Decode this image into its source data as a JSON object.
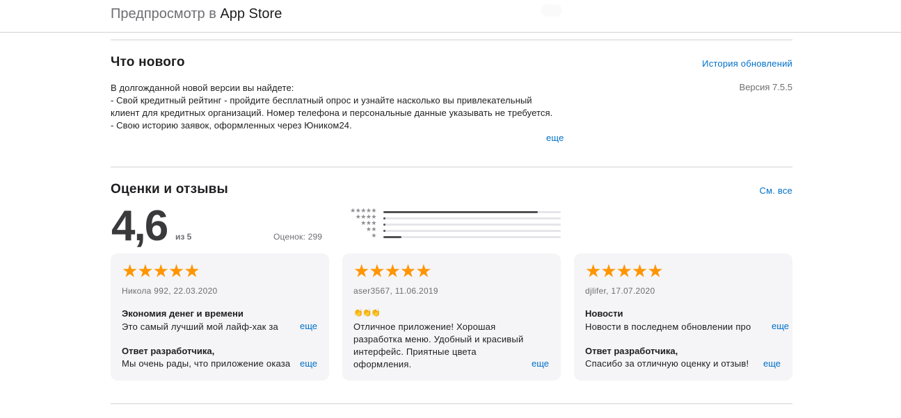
{
  "header": {
    "prefix": "Предпросмотр в",
    "app_store": "App Store"
  },
  "whats_new": {
    "title": "Что нового",
    "history_link": "История обновлений",
    "version": "Версия 7.5.5",
    "text": "В долгожданной новой версии вы найдете:\n- Свой кредитный рейтинг - пройдите бесплатный опрос и узнайте насколько вы привлекательный клиент для кредитных организаций. Номер телефона и персональные данные указывать не требуется.\n- Свою историю заявок, оформленных через Юником24.",
    "more": "еще"
  },
  "ratings": {
    "title": "Оценки и отзывы",
    "see_all": "См. все",
    "average": "4,6",
    "out_of": "из 5",
    "count": "Оценок: 299",
    "histogram": [
      {
        "stars": "★★★★★",
        "fraction": 0.87
      },
      {
        "stars": "★★★★",
        "fraction": 0.01
      },
      {
        "stars": "★★★",
        "fraction": 0.01
      },
      {
        "stars": "★★",
        "fraction": 0.01
      },
      {
        "stars": "★",
        "fraction": 0.1
      }
    ]
  },
  "reviews": [
    {
      "stars": "★★★★★",
      "meta": "Никола 992, 22.03.2020",
      "title": "Экономия денег и времени",
      "body": "Это самый лучший мой лайф-хак за",
      "more": "еще",
      "dev_title": "Ответ разработчика,",
      "dev_body": "Мы очень рады, что приложение оказа",
      "dev_more": "еще"
    },
    {
      "stars": "★★★★★",
      "meta": "aser3567, 11.06.2019",
      "title": "👏👏👏",
      "body": "Отличное приложение! Хорошая\nразработка меню. Удобный и красивый\nинтерфейс. Приятные цвета оформления.\nПриложение работает без сбоев. Оче",
      "more": "еще",
      "dev_title": "",
      "dev_body": "",
      "dev_more": ""
    },
    {
      "stars": "★★★★★",
      "meta": "djlifer, 17.07.2020",
      "title": "Новости",
      "body": "Новости в последнем обновлении про",
      "more": "еще",
      "dev_title": "Ответ разработчика,",
      "dev_body": "Спасибо за отличную оценку и отзыв!",
      "dev_more": "еще"
    }
  ]
}
